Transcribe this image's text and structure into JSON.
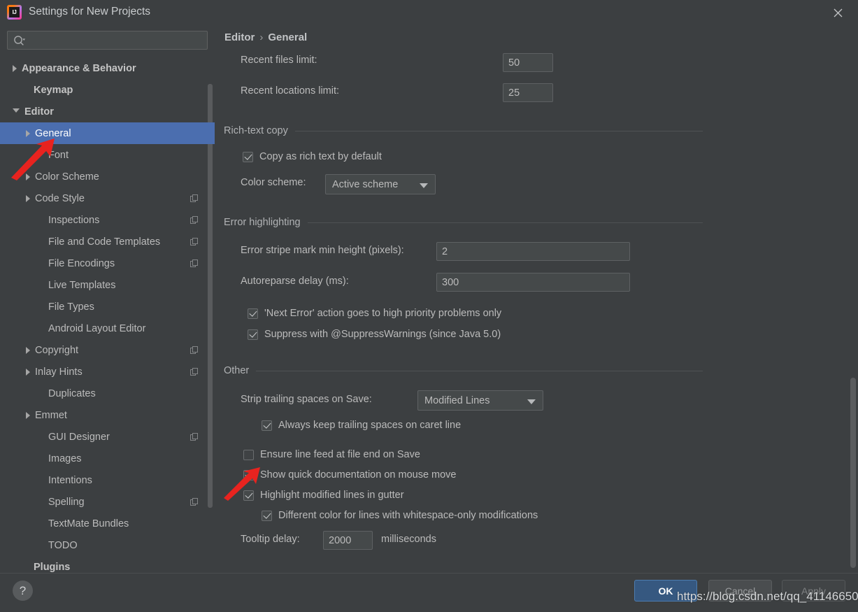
{
  "window": {
    "title": "Settings for New Projects",
    "logo_icon": "intellij-idea-logo",
    "close_icon": "close-icon"
  },
  "sidebar": {
    "search": {
      "placeholder": "",
      "value": "",
      "icon": "search-icon"
    },
    "items": [
      {
        "label": "Appearance & Behavior",
        "twisty": "collapsed",
        "indent": 18,
        "bold": true,
        "badge": false,
        "selected": false
      },
      {
        "label": "Keymap",
        "twisty": "none",
        "indent": 35,
        "bold": true,
        "badge": false,
        "selected": false
      },
      {
        "label": "Editor",
        "twisty": "expanded",
        "indent": 18,
        "bold": true,
        "badge": false,
        "selected": false
      },
      {
        "label": "General",
        "twisty": "collapsed",
        "indent": 37,
        "bold": false,
        "badge": false,
        "selected": true
      },
      {
        "label": "Font",
        "twisty": "none",
        "indent": 56,
        "bold": false,
        "badge": false,
        "selected": false
      },
      {
        "label": "Color Scheme",
        "twisty": "collapsed",
        "indent": 37,
        "bold": false,
        "badge": false,
        "selected": false
      },
      {
        "label": "Code Style",
        "twisty": "collapsed",
        "indent": 37,
        "bold": false,
        "badge": true,
        "selected": false
      },
      {
        "label": "Inspections",
        "twisty": "none",
        "indent": 56,
        "bold": false,
        "badge": true,
        "selected": false
      },
      {
        "label": "File and Code Templates",
        "twisty": "none",
        "indent": 56,
        "bold": false,
        "badge": true,
        "selected": false
      },
      {
        "label": "File Encodings",
        "twisty": "none",
        "indent": 56,
        "bold": false,
        "badge": true,
        "selected": false
      },
      {
        "label": "Live Templates",
        "twisty": "none",
        "indent": 56,
        "bold": false,
        "badge": false,
        "selected": false
      },
      {
        "label": "File Types",
        "twisty": "none",
        "indent": 56,
        "bold": false,
        "badge": false,
        "selected": false
      },
      {
        "label": "Android Layout Editor",
        "twisty": "none",
        "indent": 56,
        "bold": false,
        "badge": false,
        "selected": false
      },
      {
        "label": "Copyright",
        "twisty": "collapsed",
        "indent": 37,
        "bold": false,
        "badge": true,
        "selected": false
      },
      {
        "label": "Inlay Hints",
        "twisty": "collapsed",
        "indent": 37,
        "bold": false,
        "badge": true,
        "selected": false
      },
      {
        "label": "Duplicates",
        "twisty": "none",
        "indent": 56,
        "bold": false,
        "badge": false,
        "selected": false
      },
      {
        "label": "Emmet",
        "twisty": "collapsed",
        "indent": 37,
        "bold": false,
        "badge": false,
        "selected": false
      },
      {
        "label": "GUI Designer",
        "twisty": "none",
        "indent": 56,
        "bold": false,
        "badge": true,
        "selected": false
      },
      {
        "label": "Images",
        "twisty": "none",
        "indent": 56,
        "bold": false,
        "badge": false,
        "selected": false
      },
      {
        "label": "Intentions",
        "twisty": "none",
        "indent": 56,
        "bold": false,
        "badge": false,
        "selected": false
      },
      {
        "label": "Spelling",
        "twisty": "none",
        "indent": 56,
        "bold": false,
        "badge": true,
        "selected": false
      },
      {
        "label": "TextMate Bundles",
        "twisty": "none",
        "indent": 56,
        "bold": false,
        "badge": false,
        "selected": false
      },
      {
        "label": "TODO",
        "twisty": "none",
        "indent": 56,
        "bold": false,
        "badge": false,
        "selected": false
      },
      {
        "label": "Plugins",
        "twisty": "none",
        "indent": 35,
        "bold": true,
        "badge": false,
        "selected": false
      }
    ]
  },
  "breadcrumb": {
    "parent": "Editor",
    "separator": "›",
    "current": "General"
  },
  "general": {
    "recent_files_limit_label": "Recent files limit:",
    "recent_files_limit_value": "50",
    "recent_locations_limit_label": "Recent locations limit:",
    "recent_locations_limit_value": "25"
  },
  "rich_text_copy": {
    "section_title": "Rich-text copy",
    "copy_rich_text_label": "Copy as rich text by default",
    "copy_rich_text_checked": true,
    "color_scheme_label": "Color scheme:",
    "color_scheme_value": "Active scheme"
  },
  "error_highlighting": {
    "section_title": "Error highlighting",
    "stripe_label": "Error stripe mark min height (pixels):",
    "stripe_value": "2",
    "autoreparse_label": "Autoreparse delay (ms):",
    "autoreparse_value": "300",
    "next_error_label": "'Next Error' action goes to high priority problems only",
    "next_error_checked": true,
    "suppress_label": "Suppress with @SuppressWarnings (since Java 5.0)",
    "suppress_checked": true
  },
  "other": {
    "section_title": "Other",
    "strip_trailing_label": "Strip trailing spaces on Save:",
    "strip_trailing_value": "Modified Lines",
    "always_keep_label": "Always keep trailing spaces on caret line",
    "always_keep_checked": true,
    "ensure_line_feed_label": "Ensure line feed at file end on Save",
    "ensure_line_feed_checked": false,
    "quick_doc_label": "Show quick documentation on mouse move",
    "quick_doc_checked": true,
    "highlight_modified_label": "Highlight modified lines in gutter",
    "highlight_modified_checked": true,
    "different_color_label": "Different color for lines with whitespace-only modifications",
    "different_color_checked": true,
    "tooltip_delay_label": "Tooltip delay:",
    "tooltip_delay_value": "2000",
    "tooltip_delay_units": "milliseconds"
  },
  "footer": {
    "help_label": "?",
    "ok_label": "OK",
    "cancel_label": "Cancel",
    "apply_label": "Apply"
  },
  "watermark": {
    "text": "https://blog.csdn.net/qq_41146650"
  },
  "colors": {
    "background": "#3c3f41",
    "selection": "#4b6eaf",
    "accent_button": "#365880",
    "text": "#bbbbbb",
    "annotation_arrow": "#e8231f"
  }
}
